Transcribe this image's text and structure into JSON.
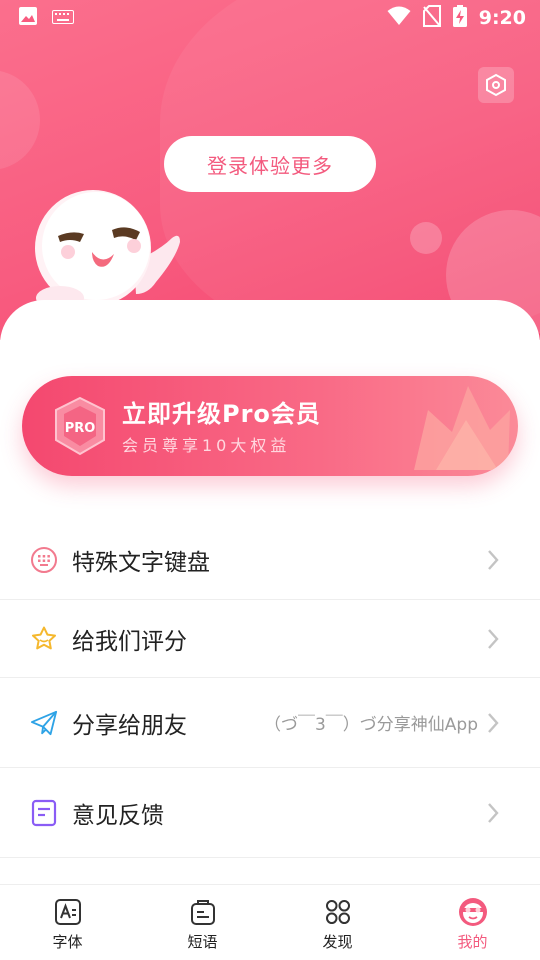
{
  "status_bar": {
    "time": "9:20"
  },
  "header": {
    "login_button": "登录体验更多"
  },
  "pro_banner": {
    "title": "立即升级Pro会员",
    "subtitle": "会员尊享10大权益",
    "badge_text": "PRO"
  },
  "menu": {
    "items": [
      {
        "label": "特殊文字键盘",
        "icon": "keyboard-icon"
      },
      {
        "label": "给我们评分",
        "icon": "star-icon"
      },
      {
        "label": "分享给朋友",
        "icon": "paper-plane-icon",
        "extra": "（づ￣3￣）づ分享神仙App"
      },
      {
        "label": "意见反馈",
        "icon": "feedback-note-icon"
      }
    ]
  },
  "tab_bar": {
    "tabs": [
      {
        "label": "字体",
        "icon": "font-icon",
        "active": false
      },
      {
        "label": "短语",
        "icon": "phrase-icon",
        "active": false
      },
      {
        "label": "发现",
        "icon": "discover-icon",
        "active": false
      },
      {
        "label": "我的",
        "icon": "profile-face-icon",
        "active": true
      }
    ]
  },
  "colors": {
    "accent": "#f35a7e",
    "header_start": "#fb6f8d",
    "header_end": "#f4446d",
    "star": "#f5b82e",
    "share": "#2ea3e6",
    "feedback": "#8a5cf5"
  }
}
